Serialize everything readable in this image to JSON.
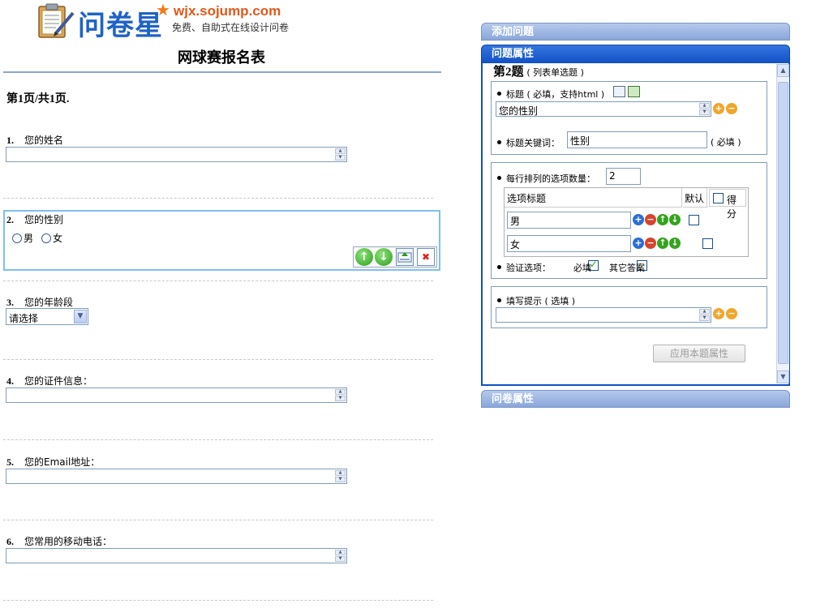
{
  "logo": {
    "brand": "问卷星",
    "star": "★",
    "url": "wjx.sojump.com",
    "slogan": "免费、自助式在线设计问卷"
  },
  "survey": {
    "title": "网球赛报名表",
    "page_info": "第1页/共1页."
  },
  "questions": [
    {
      "num": "1.",
      "label": "您的姓名",
      "value": ""
    },
    {
      "num": "2.",
      "label": "您的性别",
      "options": [
        "男",
        "女"
      ]
    },
    {
      "num": "3.",
      "label": "您的年龄段",
      "select": "请选择"
    },
    {
      "num": "4.",
      "label": "您的证件信息：",
      "value": ""
    },
    {
      "num": "5.",
      "label": "您的Email地址：",
      "value": ""
    },
    {
      "num": "6.",
      "label": "您常用的移动电话：",
      "value": ""
    }
  ],
  "q_ops": {
    "up": "↑",
    "down": "↓",
    "delete": "✖"
  },
  "panel": {
    "add_question": "添加问题",
    "question_props": "问题属性",
    "survey_props": "问卷属性",
    "q_heading": "第2题",
    "q_type": "( 列表单选题 )",
    "title_label": "标题 ( 必填，支持html )",
    "title_value": "您的性别",
    "keyword_label": "标题关键词：",
    "keyword_value": "性别",
    "keyword_required": "( 必填 )",
    "per_row_label": "每行排列的选项数量：",
    "per_row_value": "2",
    "col_option_title": "选项标题",
    "col_default": "默认",
    "col_score": "得分",
    "options": [
      "男",
      "女"
    ],
    "validate_label": "验证选项：",
    "required_label": "必填",
    "other_label": "其它答案",
    "hint_label": "填写提示 ( 选填 )",
    "hint_value": "",
    "apply": "应用本题属性",
    "plus": "+",
    "minus": "−"
  }
}
